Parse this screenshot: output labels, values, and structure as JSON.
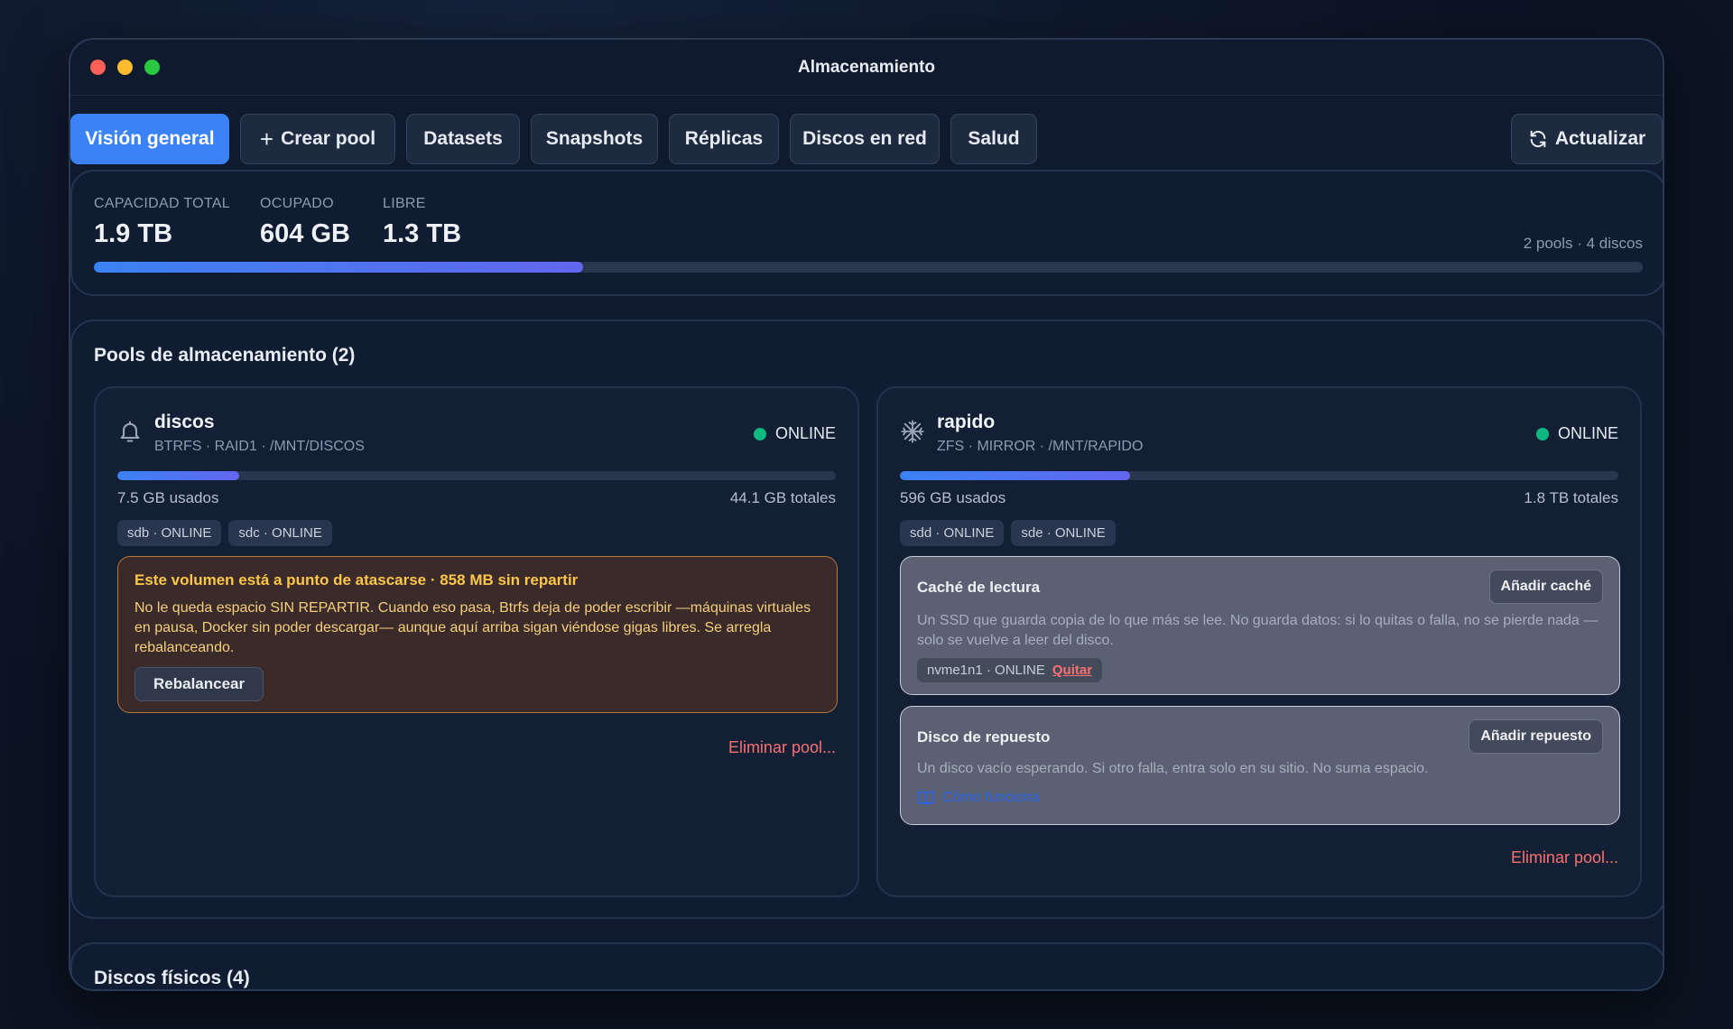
{
  "window": {
    "title": "Almacenamiento"
  },
  "tabs": [
    {
      "label": "Visión general",
      "active": true
    },
    {
      "label": "Crear pool",
      "icon": "plus-icon"
    },
    {
      "label": "Datasets"
    },
    {
      "label": "Snapshots"
    },
    {
      "label": "Réplicas"
    },
    {
      "label": "Discos en red"
    },
    {
      "label": "Salud"
    }
  ],
  "refresh_button": {
    "label": "Actualizar",
    "icon": "refresh-icon"
  },
  "capacity": {
    "total_label": "CAPACIDAD TOTAL",
    "total_value": "1.9 TB",
    "used_label": "OCUPADO",
    "used_value": "604 GB",
    "free_label": "LIBRE",
    "free_value": "1.3 TB",
    "summary": "2 pools · 4 discos",
    "used_fraction": 0.316
  },
  "pools_section": {
    "title": "Pools de almacenamiento (2)",
    "pools": [
      {
        "name": "discos",
        "icon": "bell-icon",
        "meta": "BTRFS · RAID1 · /MNT/DISCOS",
        "status": "ONLINE",
        "used": "7.5 GB usados",
        "total": "44.1 GB totales",
        "used_fraction": 0.17,
        "disks": [
          "sdb · ONLINE",
          "sdc · ONLINE"
        ],
        "warning": {
          "title": "Este volumen está a punto de atascarse · 858 MB sin repartir",
          "text": "No le queda espacio SIN REPARTIR. Cuando eso pasa, Btrfs deja de poder escribir —máquinas virtuales en pausa, Docker sin poder descargar— aunque aquí arriba sigan viéndose gigas libres. Se arregla rebalanceando.",
          "button": "Rebalancear"
        },
        "delete_label": "Eliminar pool..."
      },
      {
        "name": "rapido",
        "icon": "snowflake-icon",
        "meta": "ZFS · MIRROR · /MNT/RAPIDO",
        "status": "ONLINE",
        "used": "596 GB usados",
        "total": "1.8 TB totales",
        "used_fraction": 0.32,
        "disks": [
          "sdd · ONLINE",
          "sde · ONLINE"
        ],
        "cache": {
          "title": "Caché de lectura",
          "button": "Añadir caché",
          "text": "Un SSD que guarda copia de lo que más se lee. No guarda datos: si lo quitas o falla, no se pierde nada — solo se vuelve a leer del disco.",
          "device": "nvme1n1 · ONLINE",
          "remove": "Quitar"
        },
        "spare": {
          "title": "Disco de repuesto",
          "button": "Añadir repuesto",
          "text": "Un disco vacío esperando. Si otro falla, entra solo en su sitio. No suma espacio.",
          "link": "Cómo funciona",
          "link_icon": "book-icon"
        },
        "delete_label": "Eliminar pool..."
      }
    ]
  },
  "disks_section": {
    "title": "Discos físicos (4)"
  },
  "colors": {
    "accent": "#3b82f6",
    "online": "#10b981",
    "danger": "#f87171",
    "warning": "#fcc64a"
  }
}
